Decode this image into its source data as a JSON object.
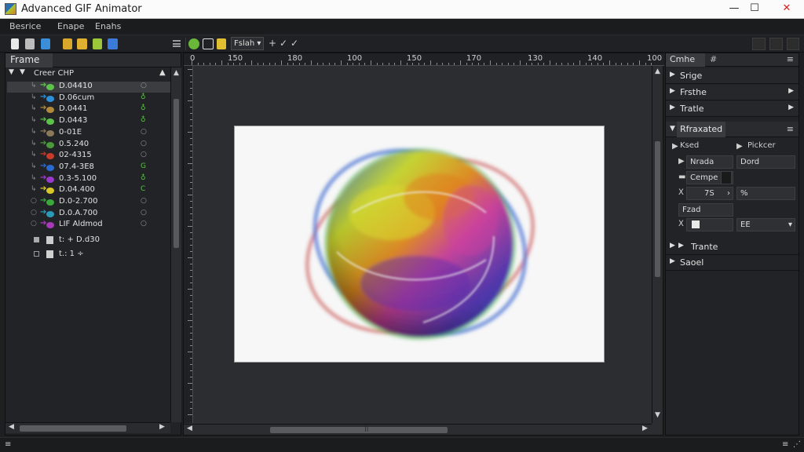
{
  "window": {
    "title": "Advanced GIF Animator",
    "minimize": "—",
    "maximize": "☐",
    "close": "✕"
  },
  "menu": [
    "Besrice",
    "Enape",
    "Enahs"
  ],
  "toolbar": {
    "dropdown": "Fslah",
    "dropdown_arrow": "▾",
    "plus": "+",
    "check1": "✓",
    "check2": "✓"
  },
  "left_panel": {
    "tab": "Frame",
    "root_label": "Creer CHP",
    "rows": [
      {
        "label": "D.04410",
        "color": "#5cc24a",
        "status": "○"
      },
      {
        "label": "D.06cum",
        "color": "#2d8fd8",
        "status": "♁"
      },
      {
        "label": "D.0441",
        "color": "#b08a3a",
        "status": "♁"
      },
      {
        "label": "D.0443",
        "color": "#5cc24a",
        "status": "♁"
      },
      {
        "label": "0-01E",
        "color": "#8a7a5a",
        "status": "○"
      },
      {
        "label": "0.5.240",
        "color": "#4a9a3a",
        "status": "○"
      },
      {
        "label": "02-4315",
        "color": "#c83a2a",
        "status": "○"
      },
      {
        "label": "07.4-3E8",
        "color": "#2a6ad0",
        "status": "G"
      },
      {
        "label": "0.3-5.100",
        "color": "#9a3ac8",
        "status": "♁"
      },
      {
        "label": "D.04.400",
        "color": "#d8c82a",
        "status": "C"
      },
      {
        "label": "D.0-2.700",
        "color": "#3aa83a",
        "status": "○"
      },
      {
        "label": "D.0.A.700",
        "color": "#2a9ab8",
        "status": "○"
      },
      {
        "label": "LIF Aldmod",
        "color": "#a83ab8",
        "status": "○"
      }
    ],
    "extra_rows": [
      {
        "label": "t: + D.d30"
      },
      {
        "label": "t.: 1 ÷"
      }
    ]
  },
  "ruler": {
    "labels": [
      "0",
      "150",
      "180",
      "100",
      "150",
      "170",
      "130",
      "140",
      "100"
    ]
  },
  "canvas_scroll": {
    "thumb_mark": "||"
  },
  "right_panel": {
    "tab": "Cmhe",
    "tab2": "#",
    "menu_icon": "≡",
    "items": [
      {
        "label": "Srige",
        "has_arrow": false
      },
      {
        "label": "Frsthe",
        "has_arrow": true
      },
      {
        "label": "Tratle",
        "has_arrow": true
      }
    ],
    "section": "Rfraxated",
    "fields": {
      "label_a": "Ksed",
      "label_b": "Pickcer",
      "label_c": "Nrada",
      "value_c": "Dord",
      "label_d": "Cempe",
      "value_x": "7S",
      "value_pct": "%",
      "label_e": "Fzad",
      "value_e": "EE"
    },
    "footer_items": [
      {
        "label": "Trante"
      },
      {
        "label": "Saoel"
      }
    ]
  },
  "colors": {
    "accent_green": "#5cc24a",
    "panel_bg": "#222326",
    "canvas_bg": "#2c2d30"
  }
}
